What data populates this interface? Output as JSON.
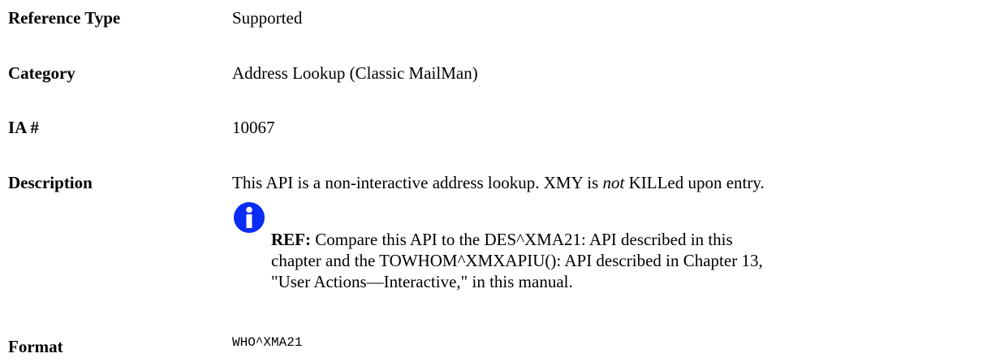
{
  "rows": {
    "reference_type": {
      "label": "Reference Type",
      "value": "Supported"
    },
    "category": {
      "label": "Category",
      "value": "Address Lookup (Classic MailMan)"
    },
    "ia": {
      "label": "IA #",
      "value": "10067"
    },
    "description": {
      "label": "Description",
      "value_before": "This API is a non-interactive address lookup. XMY is ",
      "value_emphasis": "not",
      "value_after": " KILLed upon entry."
    },
    "format": {
      "label": "Format",
      "value": "WHO^XMA21"
    }
  },
  "note": {
    "icon": "info-icon",
    "icon_glyph": "i",
    "icon_color": "#0b2cf5",
    "ref_label": "REF:",
    "line1": " Compare this API to the DES^XMA21:  API described in this",
    "line2": "chapter and the TOWHOM^XMXAPIU():  API described in Chapter 13,",
    "line3": "\"User Actions—Interactive,\" in this manual."
  }
}
